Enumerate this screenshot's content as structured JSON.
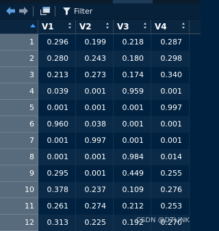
{
  "toolbar": {
    "filter_label": "Filter",
    "icons": [
      "back-arrow-icon",
      "forward-arrow-icon",
      "new-window-icon",
      "filter-funnel-icon"
    ]
  },
  "table": {
    "columns": [
      "V1",
      "V2",
      "V3",
      "V4"
    ],
    "rows": [
      {
        "n": "1",
        "v": [
          "0.296",
          "0.199",
          "0.218",
          "0.287"
        ]
      },
      {
        "n": "2",
        "v": [
          "0.280",
          "0.243",
          "0.180",
          "0.298"
        ]
      },
      {
        "n": "3",
        "v": [
          "0.213",
          "0.273",
          "0.174",
          "0.340"
        ]
      },
      {
        "n": "4",
        "v": [
          "0.039",
          "0.001",
          "0.959",
          "0.001"
        ]
      },
      {
        "n": "5",
        "v": [
          "0.001",
          "0.001",
          "0.001",
          "0.997"
        ]
      },
      {
        "n": "6",
        "v": [
          "0.960",
          "0.038",
          "0.001",
          "0.001"
        ]
      },
      {
        "n": "7",
        "v": [
          "0.001",
          "0.997",
          "0.001",
          "0.001"
        ]
      },
      {
        "n": "8",
        "v": [
          "0.001",
          "0.001",
          "0.984",
          "0.014"
        ]
      },
      {
        "n": "9",
        "v": [
          "0.295",
          "0.001",
          "0.449",
          "0.255"
        ]
      },
      {
        "n": "10",
        "v": [
          "0.378",
          "0.237",
          "0.109",
          "0.276"
        ]
      },
      {
        "n": "11",
        "v": [
          "0.261",
          "0.274",
          "0.212",
          "0.253"
        ]
      },
      {
        "n": "12",
        "v": [
          "0.313",
          "0.225",
          "0.192",
          "0.270"
        ]
      }
    ]
  },
  "watermark": "CSDN @DTLINK",
  "colors": {
    "background": "#002240",
    "row_alt": "#0a2a48",
    "rownum_bg": "#586b7d",
    "header_bg": "#092540",
    "sort_accent": "#3f9fff"
  }
}
